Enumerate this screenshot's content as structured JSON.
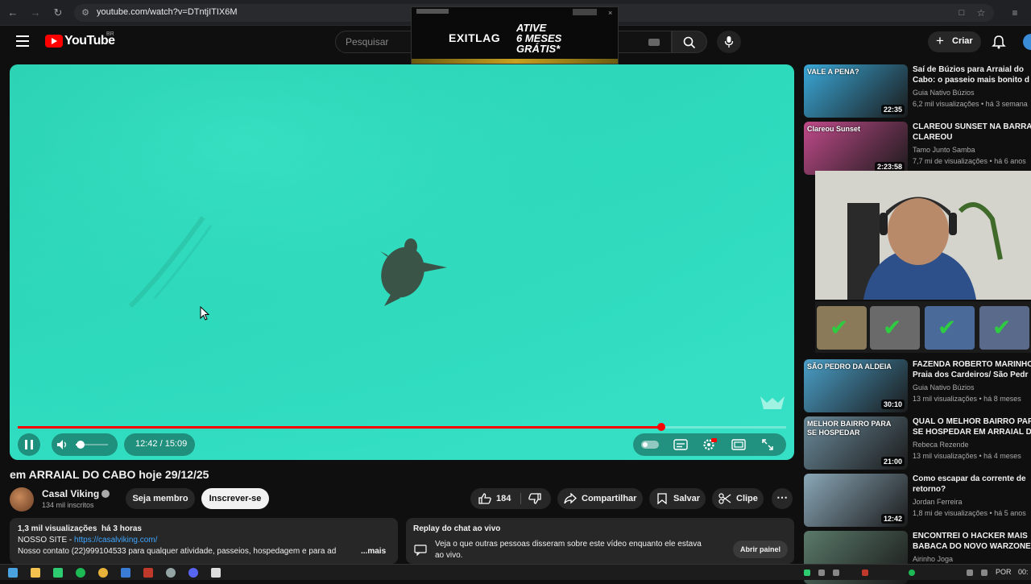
{
  "browser": {
    "url": "youtube.com/watch?v=DTntjITIX6M"
  },
  "ad": {
    "brand": "EXITLAG",
    "line1": "ATIVE",
    "line2": "6 MESES",
    "line3": "GRÁTIS*"
  },
  "header": {
    "logo_text": "YouTube",
    "country": "BR",
    "search_placeholder": "Pesquisar",
    "create_label": "Criar"
  },
  "player": {
    "time": "12:42 / 15:09",
    "progress": 0.838,
    "volume": 0.15
  },
  "video": {
    "title": "em ARRAIAL DO CABO hoje 29/12/25",
    "channel": "Casal Viking",
    "subscribers": "134 mil inscritos",
    "join_label": "Seja membro",
    "subscribe_label": "Inscrever-se",
    "likes": "184",
    "share_label": "Compartilhar",
    "save_label": "Salvar",
    "clip_label": "Clipe"
  },
  "description": {
    "stats": "1,3 mil visualizações  há 3 horas",
    "site_label": "NOSSO SITE - ",
    "site_link": "https://casalviking.com/",
    "contact": "Nosso contato (22)999104533 para qualquer atividade, passeios, hospedagem e para ad",
    "more": "...mais"
  },
  "chat": {
    "title": "Replay do chat ao vivo",
    "text1": "Veja o que outras pessoas disseram sobre este vídeo enquanto ele estava",
    "text2": "ao vivo.",
    "open_label": "Abrir painel"
  },
  "sidebar": [
    {
      "title1": "Saí de Búzios para Arraial do",
      "title2": "Cabo: o passeio mais bonito d",
      "channel": "Guia Nativo Búzios",
      "meta": "6,2 mil visualizações • há 3 semana",
      "duration": "22:35",
      "thumb_text": "VALE A PENA?",
      "color": "#3aa8d8"
    },
    {
      "title1": "CLAREOU SUNSET NA BARRA",
      "title2": "CLAREOU",
      "channel": "Tamo Junto Samba",
      "meta": "7,7 mi de visualizações • há 6 anos",
      "duration": "2:23:58",
      "thumb_text": "Clareou Sunset",
      "color": "#c04a8a"
    },
    {
      "title1": "FAZENDA ROBERTO MARINHO",
      "title2": "Praia dos Cardeiros/ São Pedr",
      "channel": "Guia Nativo Búzios",
      "meta": "13 mil visualizações • há 8 meses",
      "duration": "30:10",
      "thumb_text": "SÃO PEDRO DA ALDEIA",
      "color": "#4a9fc8"
    },
    {
      "title1": "QUAL O MELHOR BAIRRO PAR",
      "title2": "SE HOSPEDAR EM ARRAIAL D",
      "channel": "Rebeca Rezende",
      "meta": "13 mil visualizações • há 4 meses",
      "duration": "21:00",
      "thumb_text": "MELHOR BAIRRO PARA SE HOSPEDAR",
      "color": "#6a8a9a"
    },
    {
      "title1": "Como escapar da corrente de",
      "title2": "retorno?",
      "channel": "Jordan Ferreira",
      "meta": "1,8 mi de visualizações • há 5 anos",
      "duration": "12:42",
      "thumb_text": "",
      "color": "#8aa8b8"
    },
    {
      "title1": "ENCONTREI O HACKER MAIS",
      "title2": "BABACA DO NOVO WARZONE",
      "channel": "Airinho Joga",
      "meta": "",
      "duration": "",
      "thumb_text": "",
      "color": "#5a7a6a"
    }
  ],
  "taskbar": {
    "lang": "POR",
    "time": "00:"
  }
}
